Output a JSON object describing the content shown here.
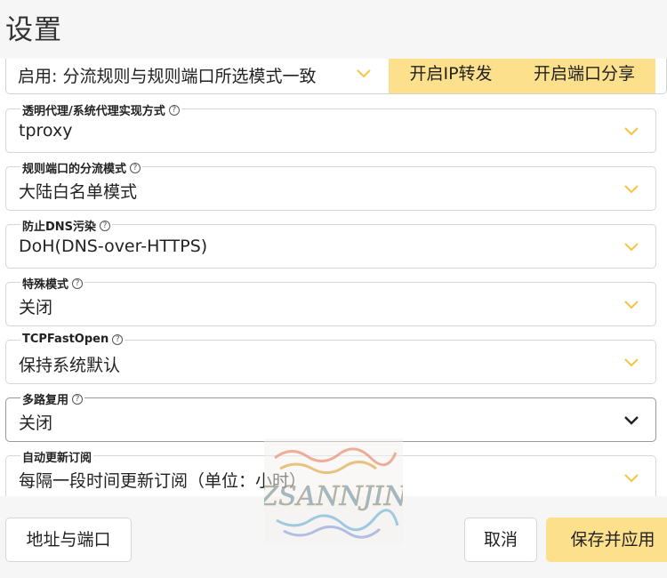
{
  "page": {
    "title": "设置"
  },
  "top_row": {
    "mode_value": "启用: 分流规则与规则端口所选模式一致",
    "ip_forward_button": "开启IP转发",
    "port_share_button": "开启端口分享"
  },
  "fields": [
    {
      "label": "透明代理/系统代理实现方式",
      "value": "tproxy",
      "help": true
    },
    {
      "label": "规则端口的分流模式",
      "value": "大陆白名单模式",
      "help": true
    },
    {
      "label": "防止DNS污染",
      "value": "DoH(DNS-over-HTTPS)",
      "help": true
    },
    {
      "label": "特殊模式",
      "value": "关闭",
      "help": true
    },
    {
      "label": "TCPFastOpen",
      "value": "保持系统默认",
      "help": true
    },
    {
      "label": "多路复用",
      "value": "关闭",
      "help": true
    },
    {
      "label": "自动更新订阅",
      "value": "每隔一段时间更新订阅（单位：小时）",
      "help": false
    }
  ],
  "footer": {
    "address_port_button": "地址与端口",
    "cancel_button": "取消",
    "save_apply_button": "保存并应用"
  },
  "watermark": {
    "text": "ZSANNJIN"
  },
  "colors": {
    "accent_yellow": "#fde08b",
    "chevron_yellow": "#f5c542",
    "background": "#f6f6f6"
  },
  "help_glyph": "?",
  "icons": {
    "dropdown": "chevron-down-icon",
    "help": "question-circle-icon"
  }
}
